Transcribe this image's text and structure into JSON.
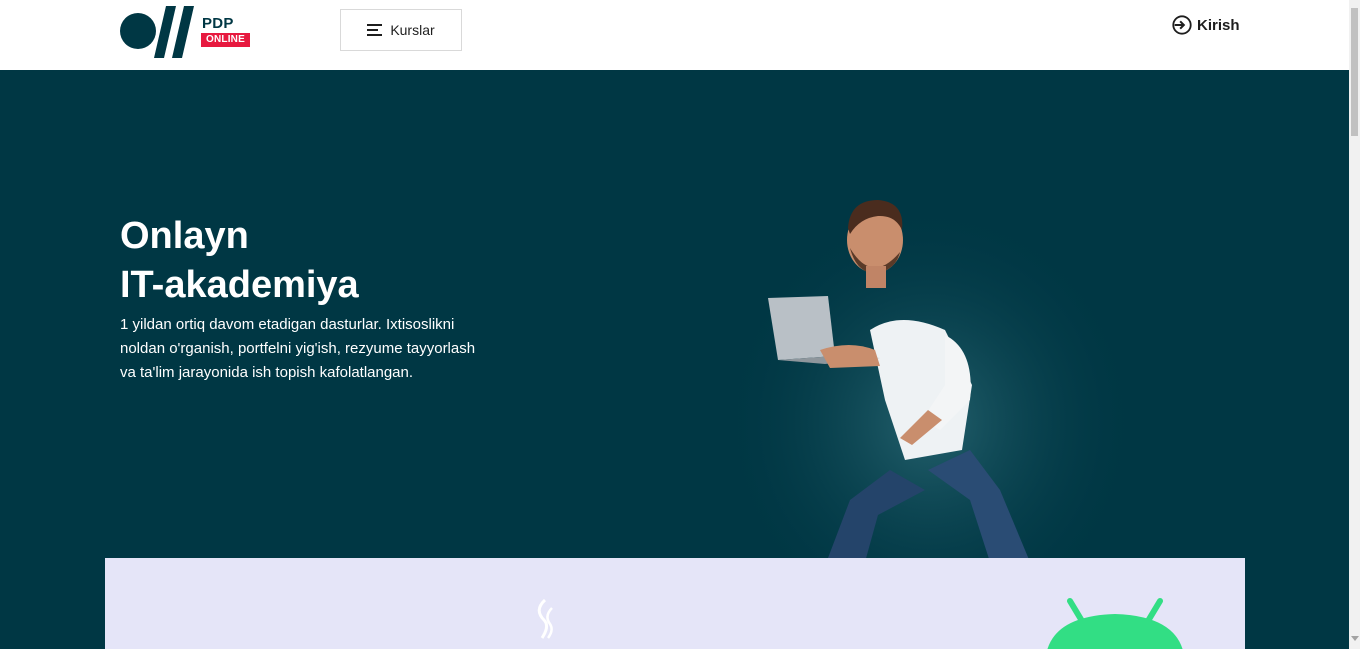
{
  "header": {
    "logo": {
      "brand": "PDP",
      "badge": "ONLINE"
    },
    "courses_button": {
      "label": "Kurslar",
      "icon": "menu-icon"
    },
    "login_button": {
      "label": "Kirish",
      "icon": "login-icon"
    }
  },
  "hero": {
    "title_line1": "Onlayn",
    "title_line2": "IT-akademiya",
    "description": "1 yildan ortiq davom etadigan dasturlar. Ixtisoslikni noldan o'rganish, portfelni yig'ish, rezyume tayyorlash va ta'lim jarayonida ish topish kafolatlangan.",
    "image": "man-with-laptop-photo"
  },
  "courses_panel": {
    "icons": [
      "java-icon",
      "android-icon"
    ]
  },
  "colors": {
    "primary_dark": "#003744",
    "brand_red": "#e7193f",
    "panel_bg": "#e5e5f8",
    "android_green": "#32de84"
  }
}
